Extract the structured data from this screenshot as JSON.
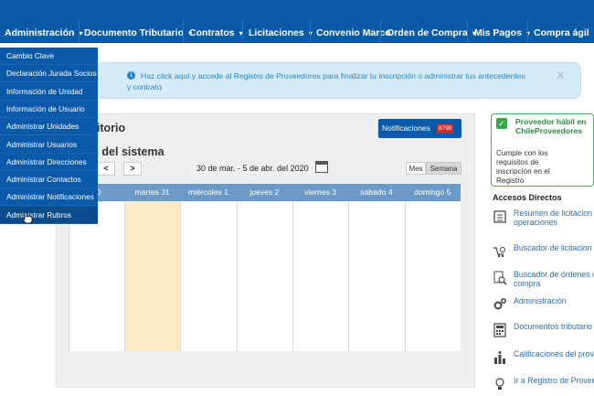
{
  "nav": [
    {
      "label": "Administración",
      "caret": "▾"
    },
    {
      "label": "Documento Tributario",
      "caret": "▾"
    },
    {
      "label": "Contratos",
      "caret": "▾"
    },
    {
      "label": "Licitaciones",
      "caret": "▾"
    },
    {
      "label": "Convenio Marco",
      "caret": ""
    },
    {
      "label": "Orden de Compra",
      "caret": "▾"
    },
    {
      "label": "Mis Pagos",
      "caret": "▾"
    },
    {
      "label": "Compra ágil",
      "caret": "▾"
    }
  ],
  "dropdown": [
    "Cambio Clave",
    "Declaración Jurada Socios",
    "Información de Unidad",
    "Información de Usuario",
    "Administrar Unidades",
    "Administrar Usuarios",
    "Administrar Direcciones",
    "Administrar Contactos",
    "Administrar Notificaciones",
    "Administrar Rubros"
  ],
  "banner": {
    "line1": "Haz click aquí y accede al Registro de Proveedores para finalizar tu inscripción o administrar tus antecedentes",
    "line2": "y contrato.",
    "close": "X"
  },
  "main": {
    "title": "ritorio",
    "events_title": "s del sistema",
    "notifications_label": "Notificaciones",
    "notifications_count": "8799",
    "prev": "<",
    "next": ">",
    "date_range": "30 de mar. - 5 de abr. del 2020",
    "view_month": "Mes",
    "view_week": "Semana"
  },
  "calendar": {
    "days": [
      "30",
      "martes 31",
      "miércoles 1",
      "jueves 2",
      "viernes 3",
      "sábado 4",
      "domingo 5"
    ],
    "today_index": 1
  },
  "status": {
    "title": "Proveedor hábil en ChileProveedores",
    "description": "Cumple con los requisitos de inscripción en el Registro"
  },
  "accesos": {
    "title": "Accesos Directos",
    "items": [
      {
        "label1": "Resumen de licitacion",
        "label2": "operaciones",
        "icon": "list-icon"
      },
      {
        "label1": "Buscador de licitacion",
        "label2": "",
        "icon": "cart-search-icon"
      },
      {
        "label1": "Buscador de órdenes d",
        "label2": "compra",
        "icon": "document-search-icon"
      },
      {
        "label1": "Administración",
        "label2": "",
        "icon": "gears-icon"
      },
      {
        "label1": "Documentos tributario",
        "label2": "",
        "icon": "calculator-icon"
      },
      {
        "label1": "Calificaciones del prov",
        "label2": "",
        "icon": "ranking-icon"
      },
      {
        "label1": "Ir a Registro de Provee",
        "label2": "",
        "icon": "lightbulb-icon"
      }
    ]
  },
  "colors": {
    "nav_bg": "#0b5aa9",
    "banner_bg": "#d5ebf7",
    "status_green": "#3aa64a",
    "calendar_header": "#6b9ac9",
    "today_bg": "#fcebc7",
    "badge_red": "#d32a2a"
  }
}
